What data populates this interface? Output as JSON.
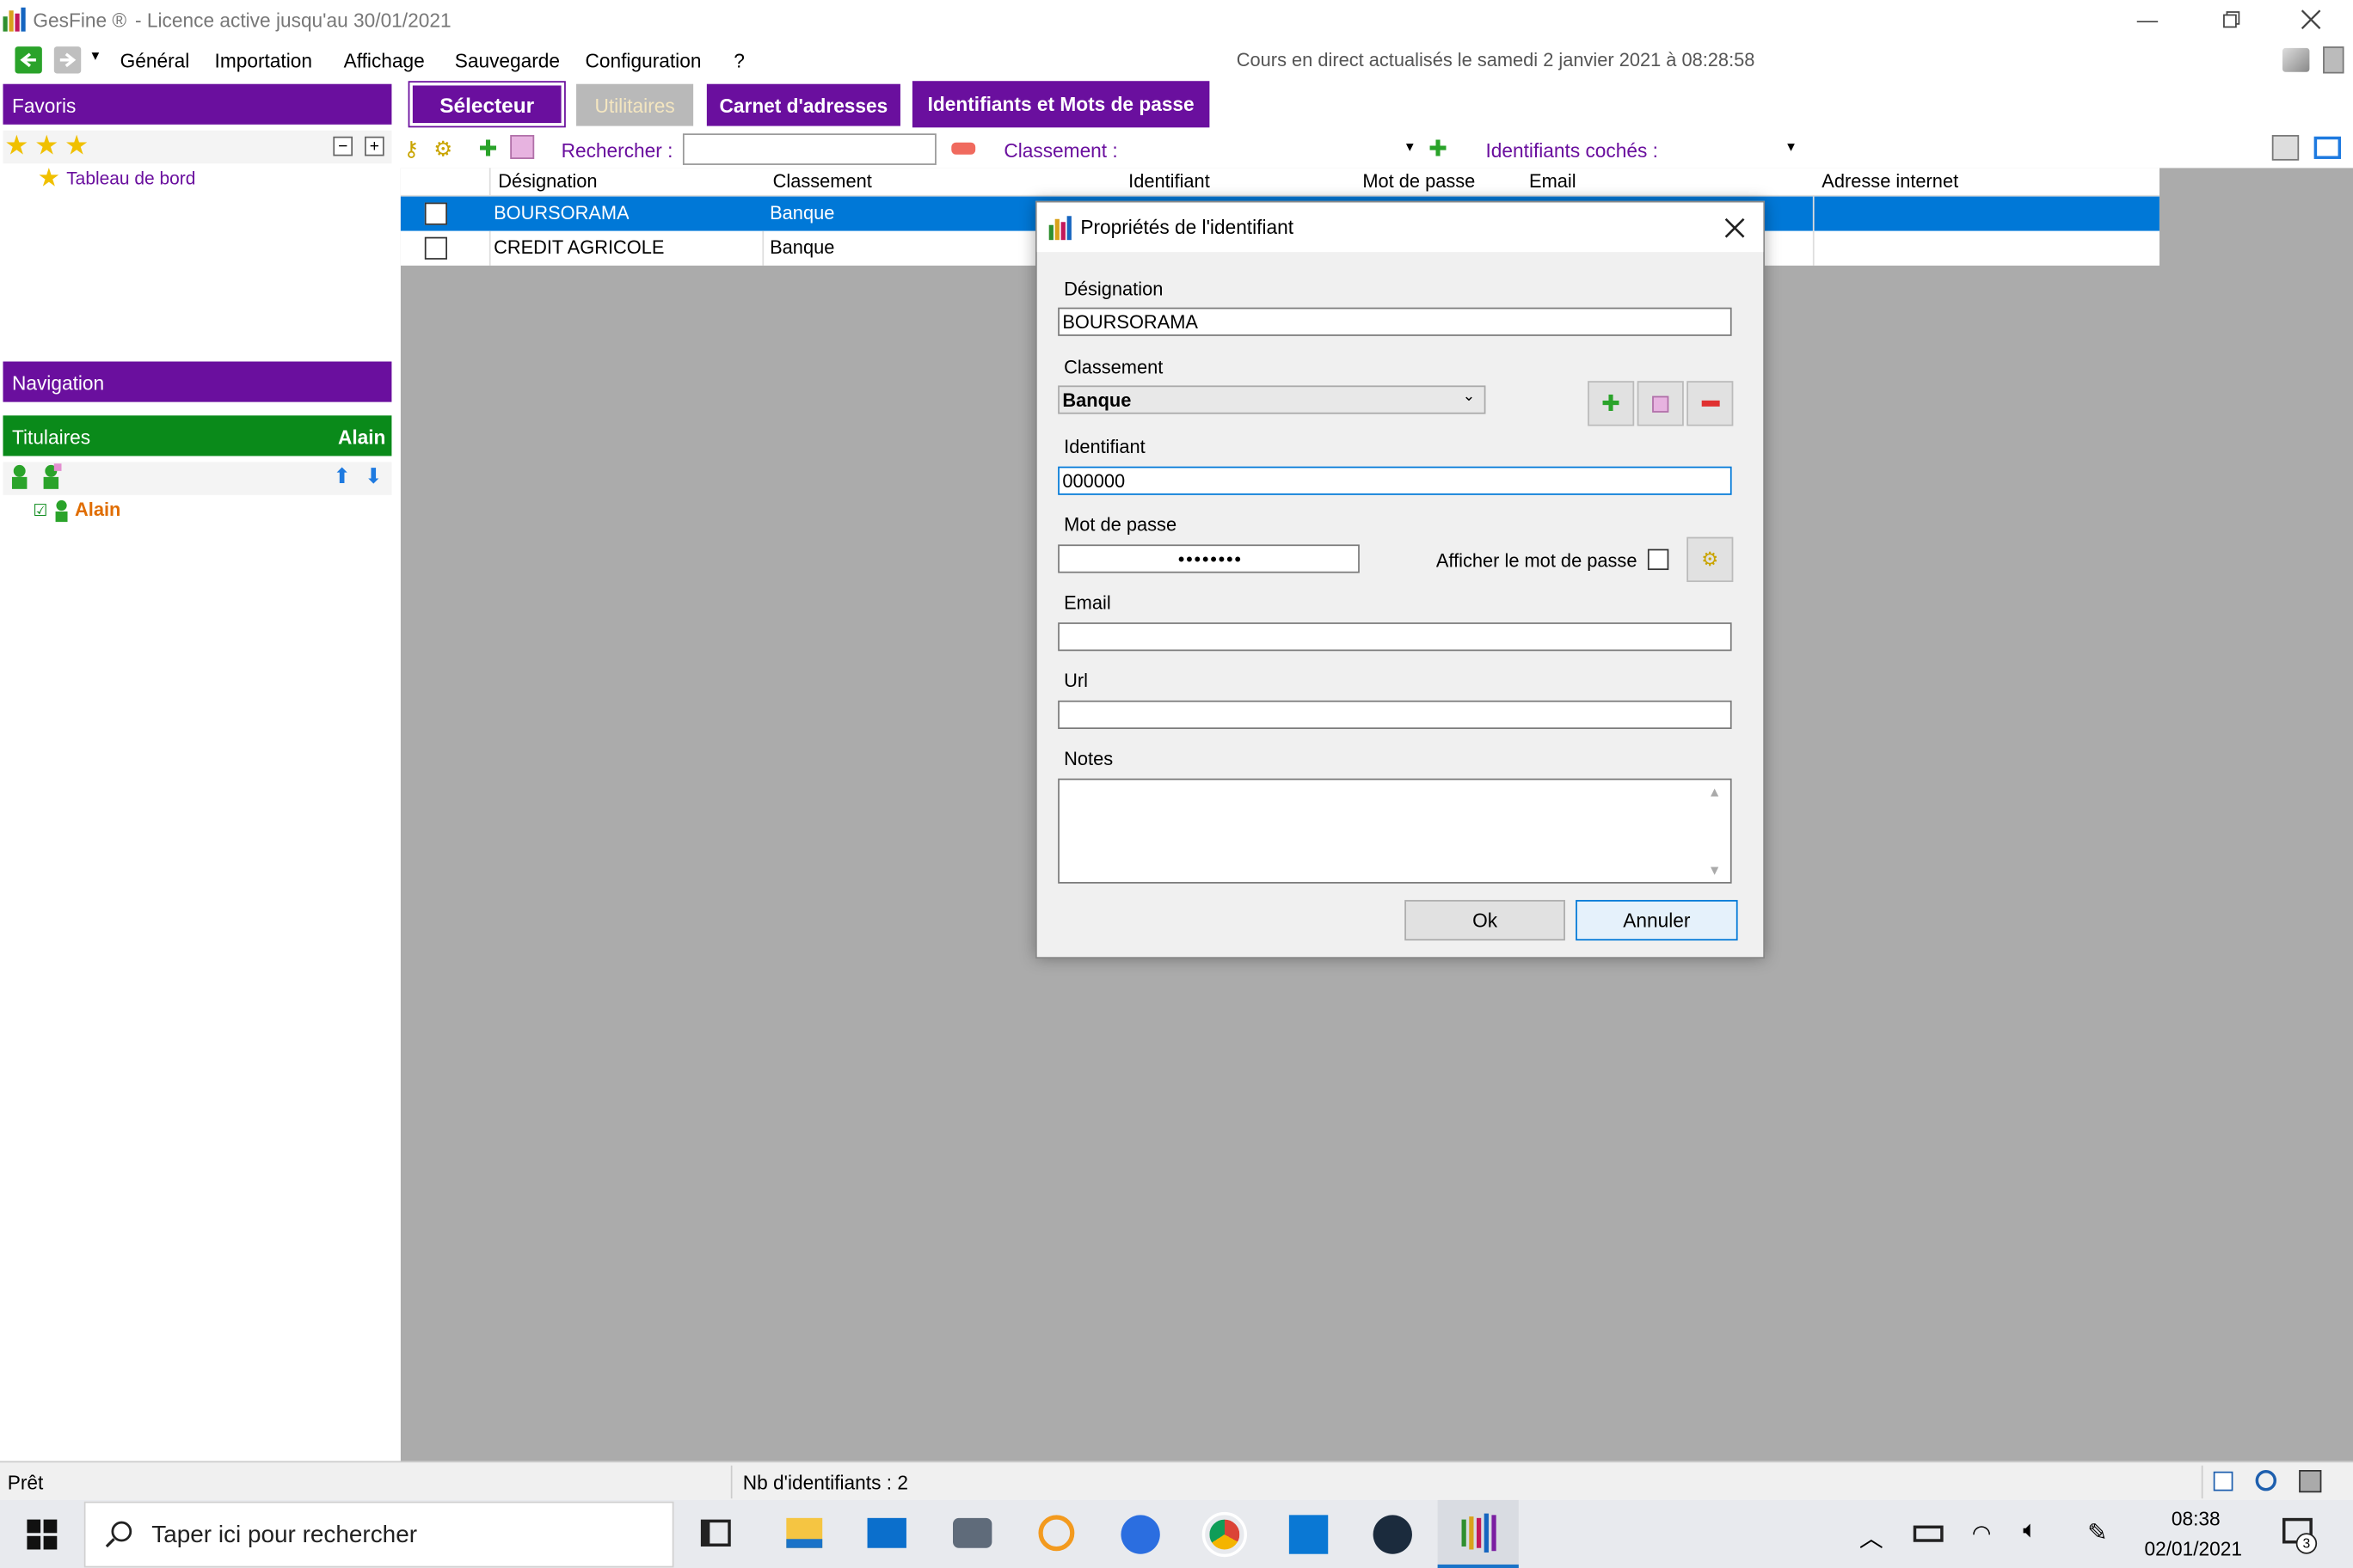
{
  "titlebar": {
    "app_name": "GesFine ®",
    "license": "- Licence active jusqu'au 30/01/2021"
  },
  "menu": {
    "items": [
      "Général",
      "Importation",
      "Affichage",
      "Sauvegarde",
      "Configuration",
      "?"
    ],
    "status": "Cours en direct actualisés le samedi 2 janvier 2021 à 08:28:58"
  },
  "sidebar": {
    "favoris_title": "Favoris",
    "favoris_item": "Tableau de bord",
    "navigation_title": "Navigation",
    "titulaires_title": "Titulaires",
    "titulaires_user": "Alain",
    "titulaire_item": "Alain"
  },
  "tabs": {
    "selecteur": "Sélecteur",
    "utilitaires": "Utilitaires",
    "carnet": "Carnet d'adresses",
    "identifiants": "Identifiants et Mots de passe"
  },
  "toolbar": {
    "search_label": "Rechercher :",
    "search_value": "",
    "classement_label": "Classement :",
    "checked_label": "Identifiants cochés :"
  },
  "grid": {
    "columns": [
      "Désignation",
      "Classement",
      "Identifiant",
      "Mot de passe",
      "Email",
      "Adresse internet"
    ],
    "rows": [
      {
        "designation": "BOURSORAMA",
        "classement": "Banque",
        "selected": true
      },
      {
        "designation": "CREDIT AGRICOLE",
        "classement": "Banque",
        "selected": false
      }
    ]
  },
  "dialog": {
    "title": "Propriétés de l'identifiant",
    "designation_label": "Désignation",
    "designation_value": "BOURSORAMA",
    "classement_label": "Classement",
    "classement_value": "Banque",
    "identifiant_label": "Identifiant",
    "identifiant_value": "000000",
    "password_label": "Mot de passe",
    "password_value": "••••••••",
    "show_password_label": "Afficher le mot de passe",
    "email_label": "Email",
    "url_label": "Url",
    "notes_label": "Notes",
    "ok": "Ok",
    "cancel": "Annuler"
  },
  "statusbar": {
    "ready": "Prêt",
    "count": "Nb d'identifiants : 2"
  },
  "taskbar": {
    "search_placeholder": "Taper ici pour rechercher",
    "time": "08:38",
    "date": "02/01/2021",
    "notif_count": "3"
  },
  "colors": {
    "purple": "#6a0f9e",
    "green": "#0a8a1a",
    "selected": "#0078d7",
    "workspace": "#ababab",
    "taskbar": "#e8eaee"
  }
}
